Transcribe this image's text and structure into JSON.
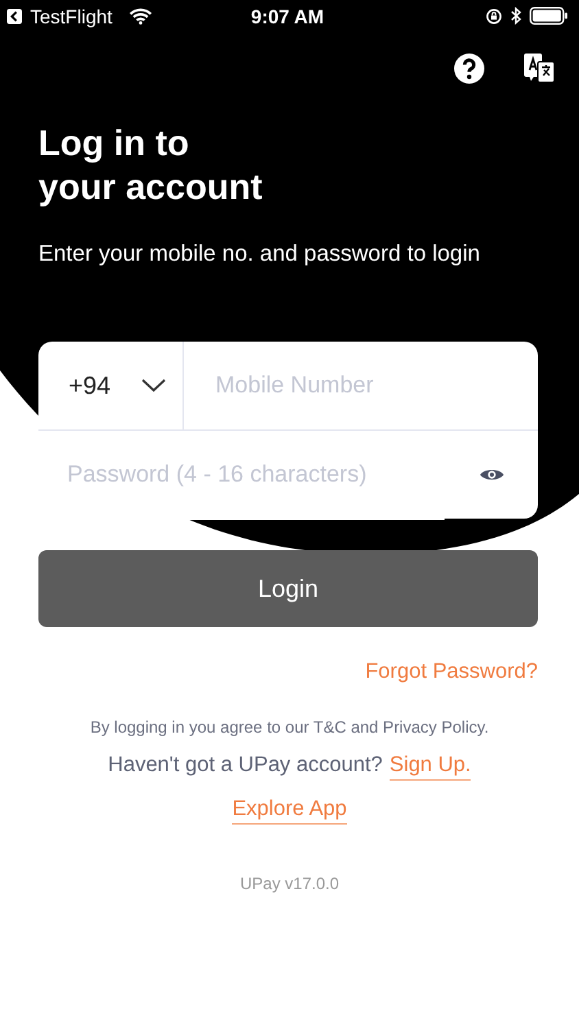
{
  "status_bar": {
    "back_app": "TestFlight",
    "time": "9:07 AM"
  },
  "header": {
    "title": "Log in to\nyour account",
    "subtitle": "Enter your mobile no. and password to login"
  },
  "form": {
    "country_code": "+94",
    "mobile": {
      "placeholder": "Mobile Number"
    },
    "password": {
      "placeholder": "Password (4 - 16 characters)"
    }
  },
  "login_button": {
    "label": "Login",
    "disabled": true
  },
  "forgot_password": "Forgot Password?",
  "terms": "By logging in you agree to our T&C and Privacy Policy.",
  "signup": {
    "prompt": "Haven't got a UPay account?",
    "link": "Sign Up."
  },
  "explore": "Explore App",
  "version": "UPay v17.0.0"
}
